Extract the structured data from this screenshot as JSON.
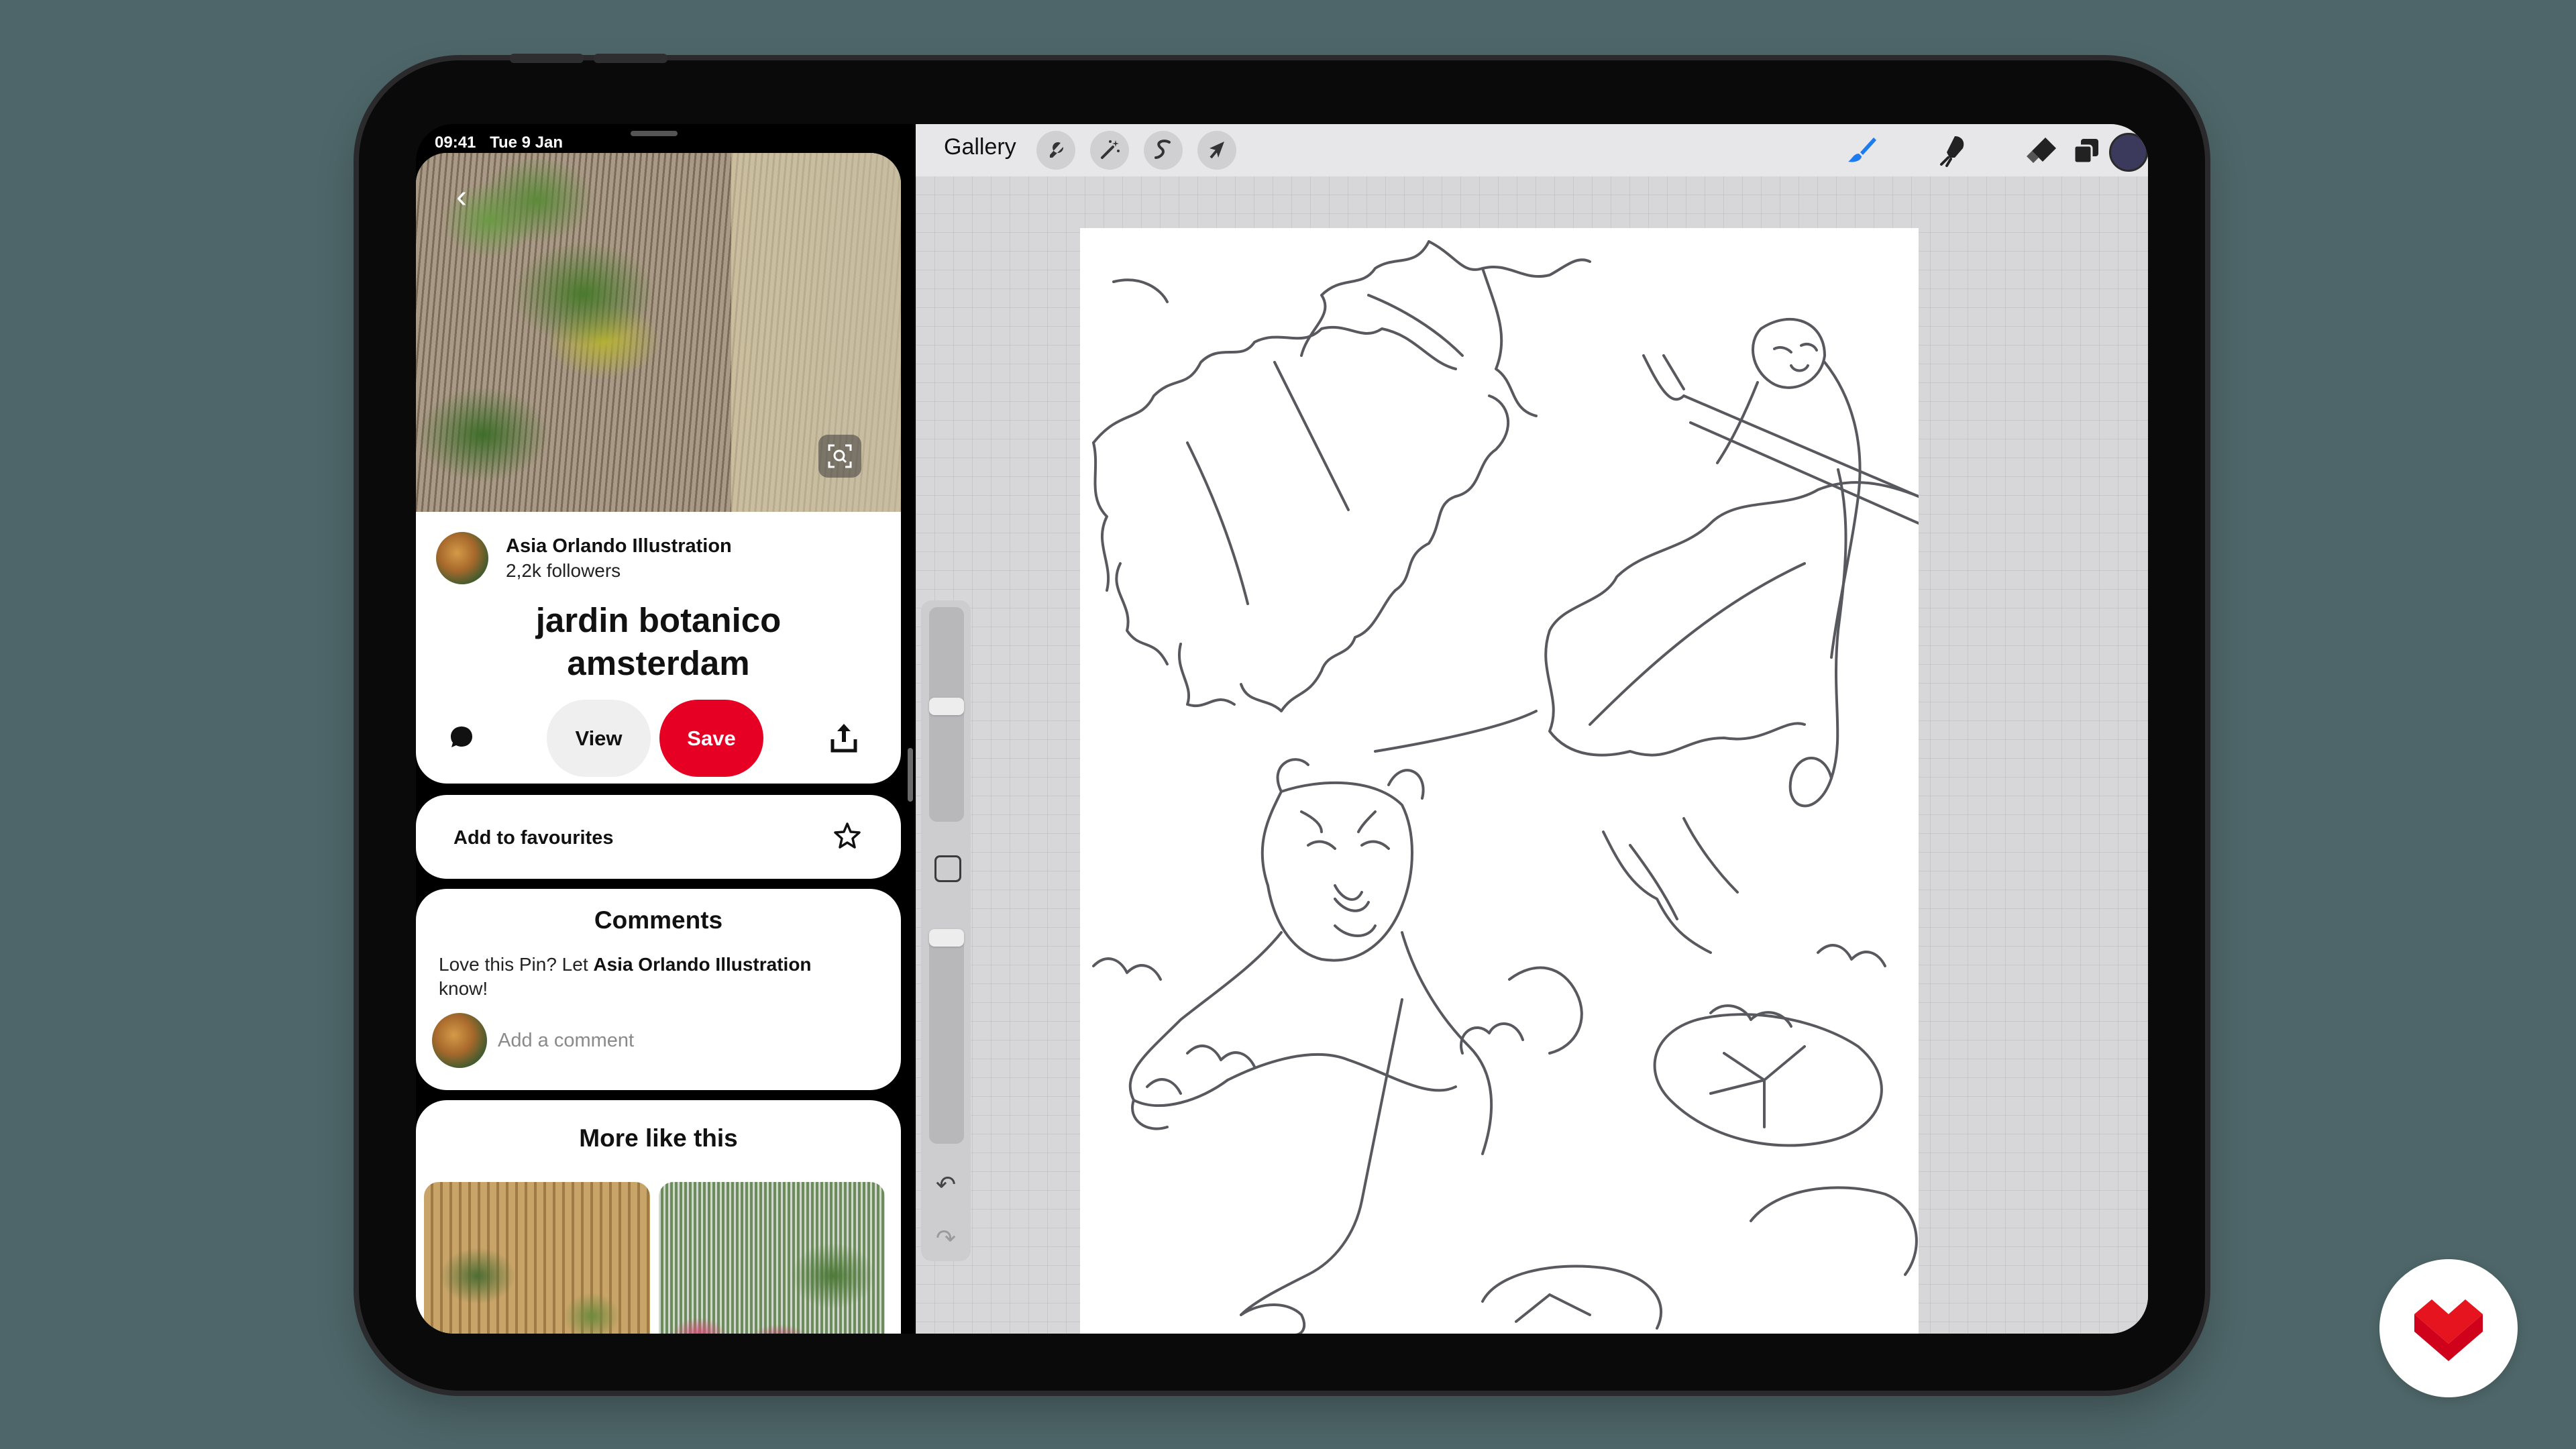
{
  "status_bar": {
    "time": "09:41",
    "date": "Tue 9 Jan"
  },
  "pinterest": {
    "author": {
      "name": "Asia Orlando Illustration",
      "followers": "2,2k followers"
    },
    "title_line1": "jardin botanico",
    "title_line2": "amsterdam",
    "buttons": {
      "view": "View",
      "save": "Save"
    },
    "favourites": {
      "label": "Add to favourites"
    },
    "comments": {
      "title": "Comments",
      "prompt_prefix": "Love this Pin? Let ",
      "prompt_name": "Asia Orlando Illustration",
      "prompt_suffix": " know!",
      "placeholder": "Add a comment"
    },
    "more": {
      "title": "More like this"
    },
    "colors": {
      "save": "#e60023",
      "view": "#efefef"
    }
  },
  "procreate": {
    "gallery_label": "Gallery",
    "left_tools": [
      "wrench-icon",
      "magic-wand-icon",
      "selection-icon",
      "transform-arrow-icon"
    ],
    "right_tools": [
      "brush-icon",
      "smudge-icon",
      "eraser-icon",
      "layers-icon"
    ],
    "active_tool": "brush-icon",
    "active_color": "#3b3a5c",
    "accent": "#1d7bf0"
  },
  "logo": {
    "name": "domestika-logo-icon",
    "color": "#d0021b"
  }
}
